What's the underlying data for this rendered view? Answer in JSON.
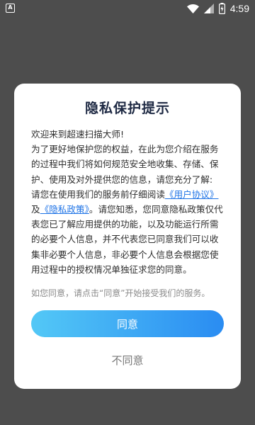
{
  "status_bar": {
    "left_icon_letter": "A",
    "time": "4:59",
    "icons": [
      "wifi-icon",
      "signal-icon",
      "battery-icon"
    ]
  },
  "dialog": {
    "title": "隐私保护提示",
    "paragraph_1": "欢迎来到超速扫描大师!",
    "paragraph_2": "为了更好地保护您的权益，在此为您介绍在服务的过程中我们将如何规范安全地收集、存储、保护、使用及对外提供您的信息，请您充分了解:",
    "paragraph_3_prefix": "请您在使用我们的服务前仔细阅读",
    "user_agreement_link": "《用户协议》",
    "paragraph_3_and": "及",
    "privacy_policy_link": "《隐私政策》",
    "paragraph_3_suffix": "。请您知悉，您同意隐私政策仅代表您已了解应用提供的功能，以及功能运行所需的必要个人信息，并不代表您已同意我们可以收集非必要个人信息，非必要个人信息会根据您使用过程中的授权情况单独征求您的同意。",
    "hint": "如您同意，请点击“同意”开始接受我们的服务。",
    "agree_label": "同意",
    "disagree_label": "不同意"
  },
  "colors": {
    "overlay": "#4d4d4d",
    "link": "#1e73e6",
    "button_gradient_start": "#53c8f6",
    "button_gradient_end": "#2a8cf2"
  }
}
